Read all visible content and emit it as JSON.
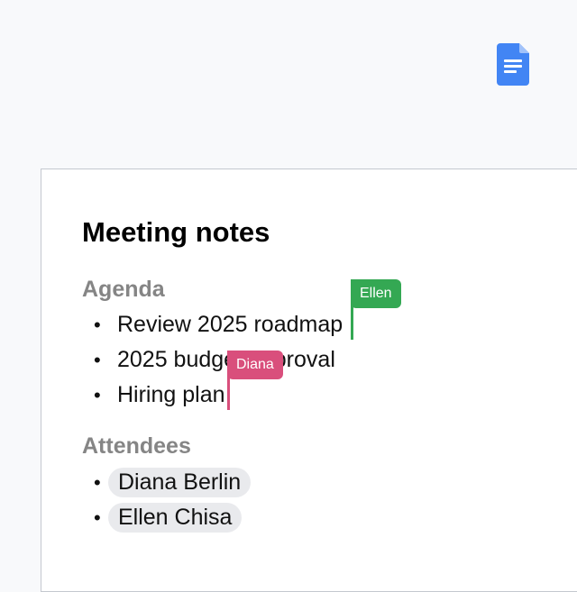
{
  "app": {
    "logo_icon": "google-docs-icon"
  },
  "document": {
    "title": "Meeting notes",
    "agenda": {
      "heading": "Agenda",
      "items": [
        "Review 2025 roadmap",
        "2025 budget approval",
        "Hiring plan"
      ]
    },
    "attendees": {
      "heading": "Attendees",
      "people": [
        "Diana Berlin",
        "Ellen Chisa"
      ]
    }
  },
  "collaborators": [
    {
      "name": "Ellen",
      "color": "#34a853"
    },
    {
      "name": "Diana",
      "color": "#d94f7c"
    }
  ],
  "colors": {
    "background": "#f8f9fb",
    "page": "#ffffff",
    "heading_gray": "#858585",
    "chip_background": "#e9eaed",
    "docs_blue": "#4285f4"
  }
}
